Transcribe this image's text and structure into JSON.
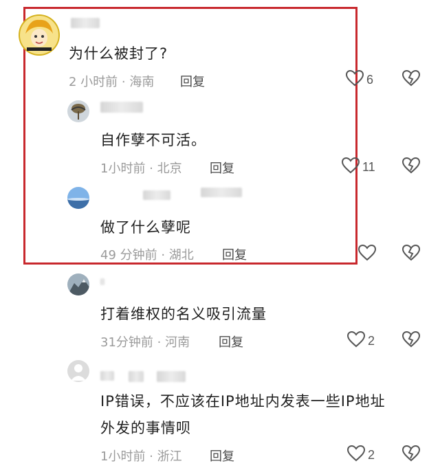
{
  "comments": [
    {
      "text": "为什么被封了?",
      "meta": "2 小时前 · 海南",
      "reply": "回复",
      "likes": "6"
    },
    {
      "text": "自作孽不可活。",
      "meta": "1小时前 · 北京",
      "reply": "回复",
      "likes": "11"
    },
    {
      "text": "做了什么孽呢",
      "meta": "49 分钟前 · 湖北",
      "reply": "回复",
      "likes": ""
    },
    {
      "text": "打着维权的名义吸引流量",
      "meta": "31分钟前 · 河南",
      "reply": "回复",
      "likes": "2"
    },
    {
      "text_line1": "IP错误，不应该在IP地址内发表一些IP地址",
      "text_line2": "外发的事情呗",
      "meta": "1小时前 · 浙江",
      "reply": "回复",
      "likes": "2"
    }
  ],
  "colors": {
    "highlight": "#c8282d",
    "meta": "#9a9a9a",
    "text": "#1e1e1e"
  },
  "icons": {
    "like": "heart-outline-icon",
    "dislike": "broken-heart-icon"
  }
}
